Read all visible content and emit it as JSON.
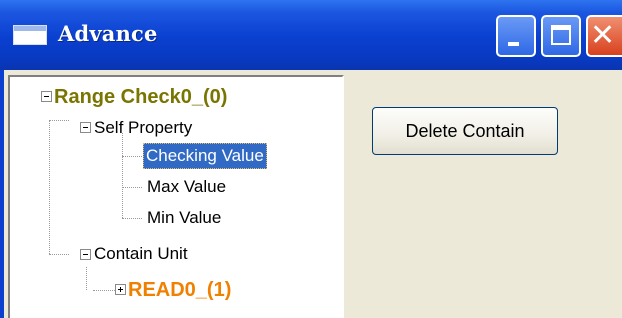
{
  "window": {
    "title": "Advance",
    "controls": {
      "minimize": "minimize",
      "maximize": "maximize",
      "close": "close"
    }
  },
  "tree": {
    "root": {
      "label": "Range Check0_(0)",
      "color": "#7a7500",
      "expanded": true
    },
    "self_property": {
      "label": "Self Property",
      "expanded": true
    },
    "checking_value": {
      "label": "Checking Value",
      "selected": true
    },
    "max_value": {
      "label": "Max Value"
    },
    "min_value": {
      "label": "Min Value"
    },
    "contain_unit": {
      "label": "Contain Unit",
      "expanded": true
    },
    "read0": {
      "label": "READ0_(1)",
      "color": "#f08000",
      "expanded": false
    }
  },
  "buttons": {
    "delete_contain": "Delete Contain"
  },
  "colors": {
    "titlebar": "#0a3fcf",
    "selection": "#316ac5",
    "background": "#ece9d8"
  }
}
